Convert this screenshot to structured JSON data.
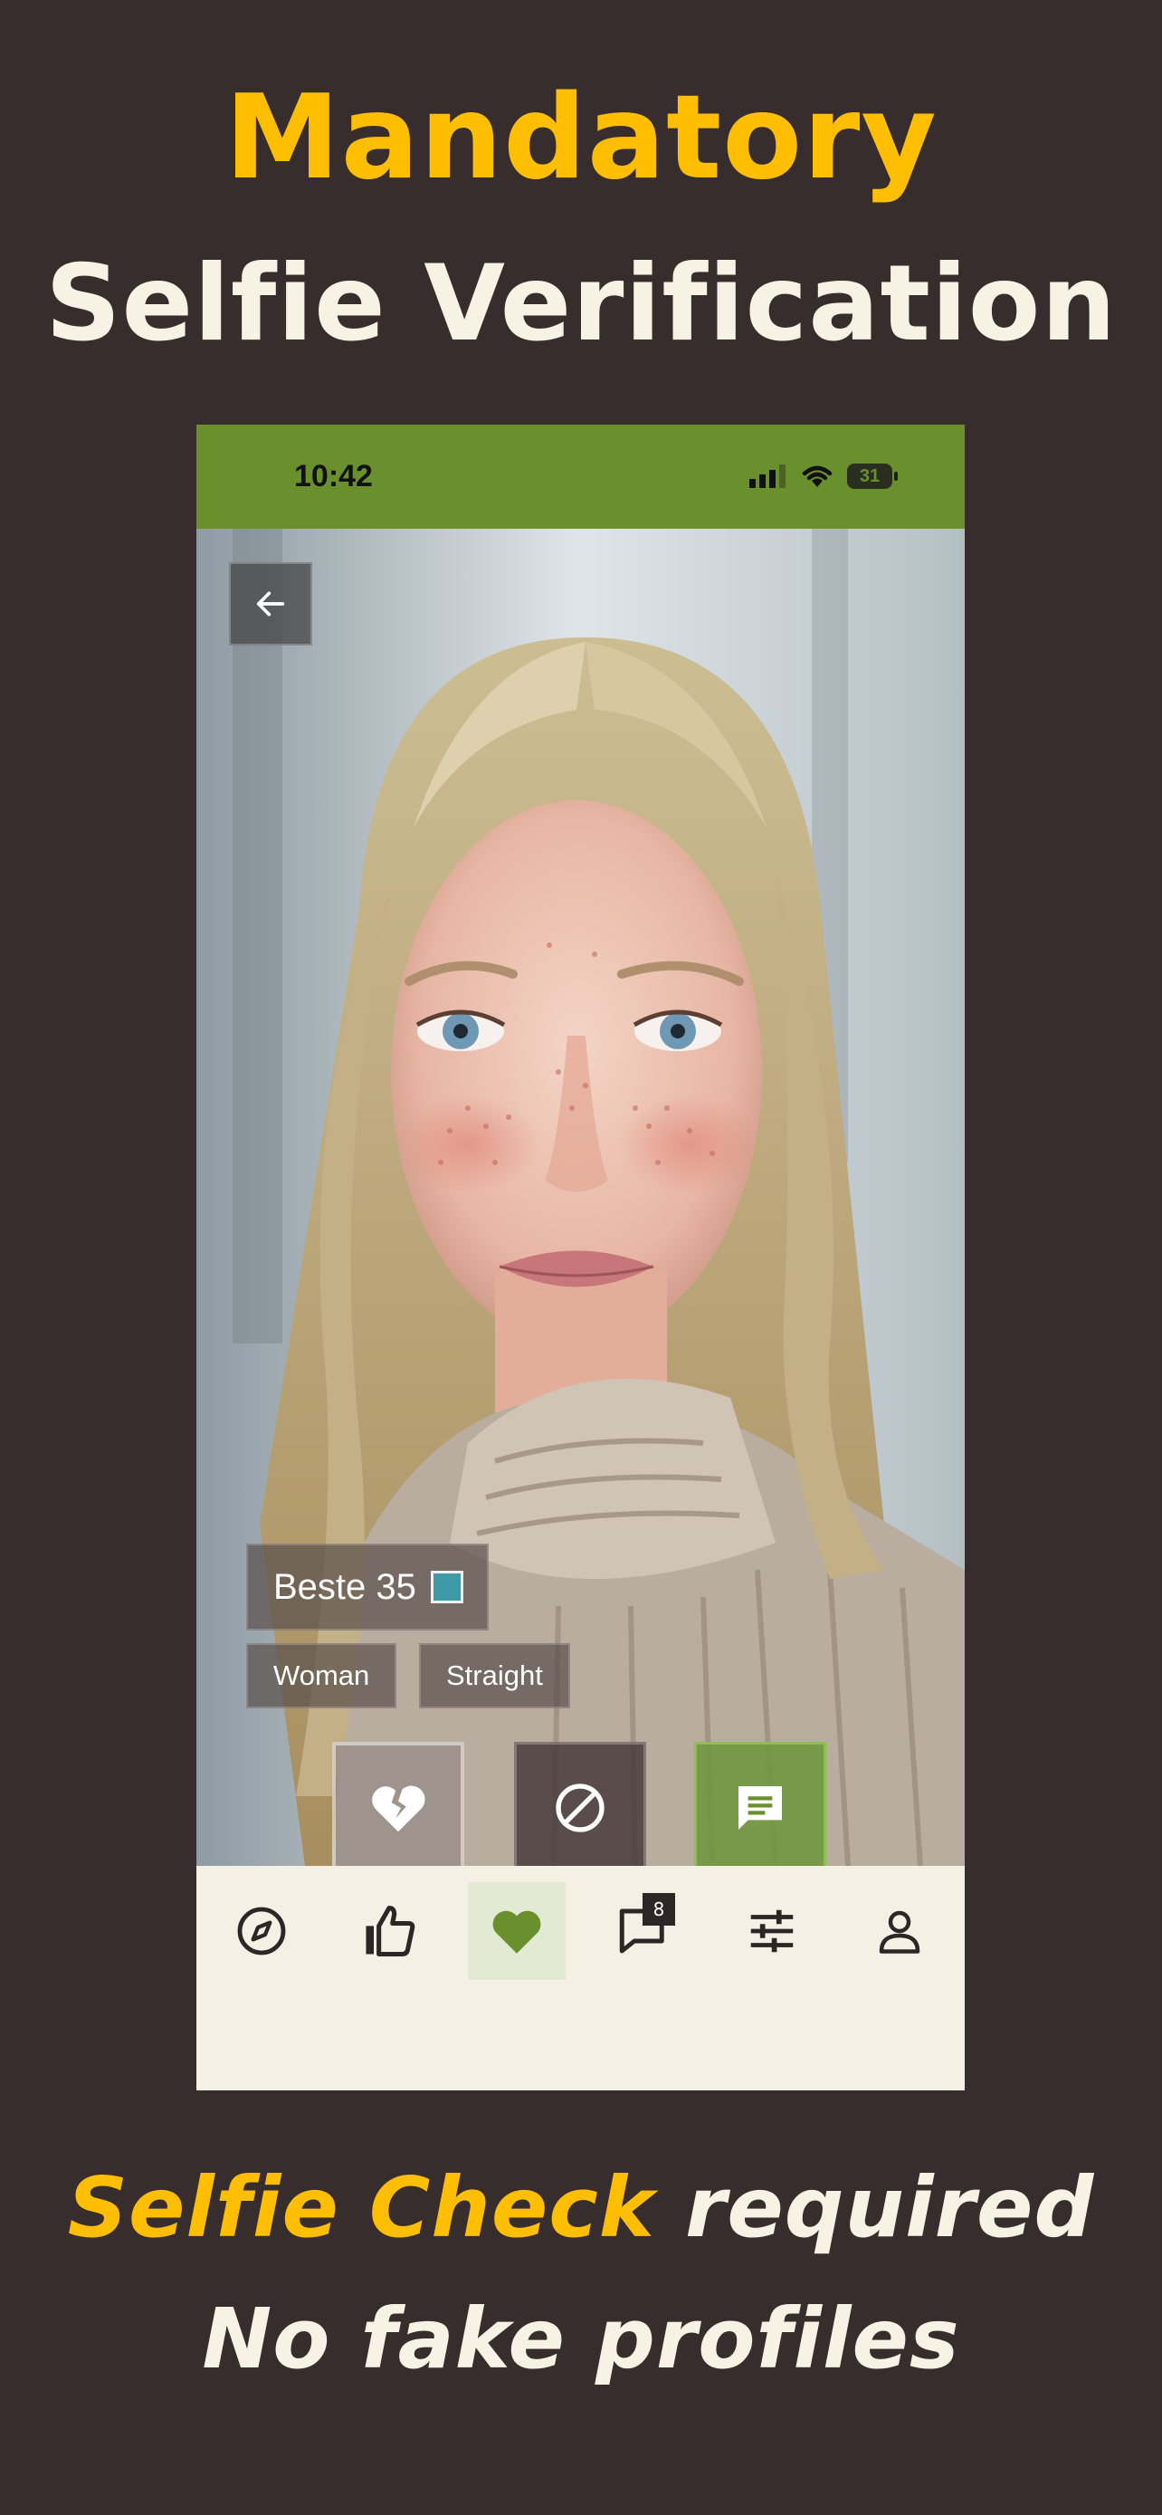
{
  "headline": {
    "line1": "Mandatory",
    "line2": "Selfie Verification"
  },
  "footer": {
    "line1_accent": "Selfie Check",
    "line1_rest": "required",
    "line2": "No fake profiles"
  },
  "status_bar": {
    "time": "10:42",
    "battery": "31"
  },
  "profile": {
    "name_age": "Beste 35",
    "tags": [
      "Woman",
      "Straight"
    ]
  },
  "bottom_nav": {
    "messages_badge": "8"
  },
  "colors": {
    "background": "#382d2d",
    "accent_yellow": "#ffbf00",
    "cream": "#f7f2e3",
    "brand_green": "#6a902e"
  }
}
